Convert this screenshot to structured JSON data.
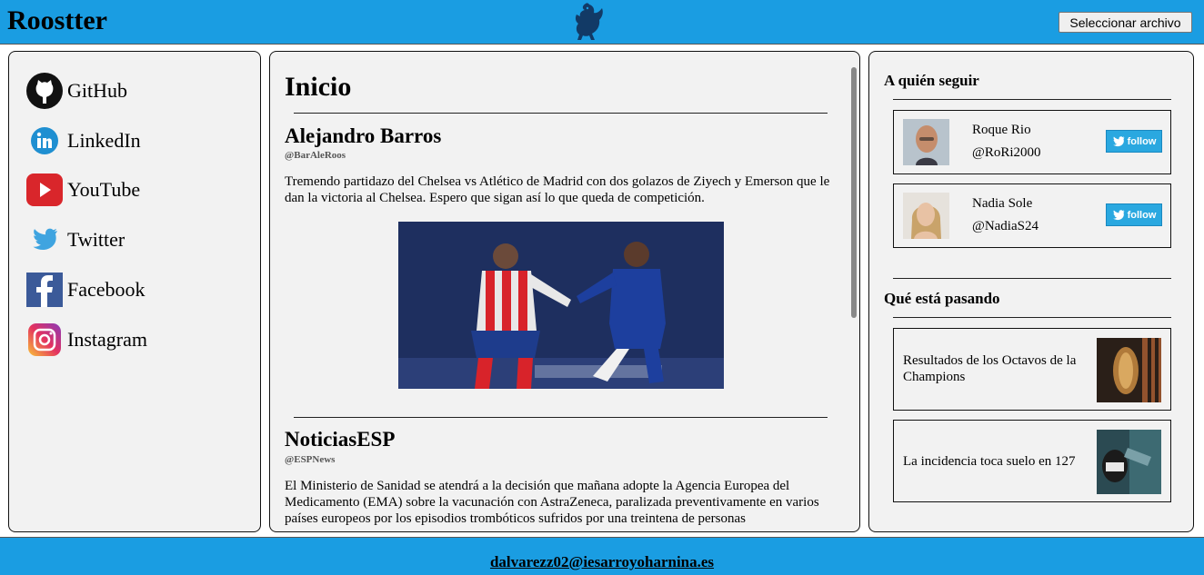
{
  "header": {
    "brand": "Roostter",
    "logo_icon": "rooster-icon",
    "file_button": "Seleccionar archivo",
    "bg_color": "#1a9de2"
  },
  "sidebar": {
    "links": [
      {
        "label": "GitHub",
        "icon": "github-icon"
      },
      {
        "label": "LinkedIn",
        "icon": "linkedin-icon"
      },
      {
        "label": "YouTube",
        "icon": "youtube-icon"
      },
      {
        "label": "Twitter",
        "icon": "twitter-icon"
      },
      {
        "label": "Facebook",
        "icon": "facebook-icon"
      },
      {
        "label": "Instagram",
        "icon": "instagram-icon"
      }
    ]
  },
  "feed": {
    "title": "Inicio",
    "posts": [
      {
        "name": "Alejandro Barros",
        "handle": "@BarAleRoos",
        "text": "Tremendo partidazo del Chelsea vs Atlético de Madrid con dos golazos de Ziyech y Emerson que le dan la victoria al Chelsea. Espero que sigan así lo que queda de competición."
      },
      {
        "name": "NoticiasESP",
        "handle": "@ESPNews",
        "text": "El Ministerio de Sanidad se atendrá a la decisión que mañana adopte la Agencia Europea del Medicamento (EMA) sobre la vacunación con AstraZeneca, paralizada preventivamente en varios países europeos por los episodios trombóticos sufridos por una treintena de personas"
      }
    ]
  },
  "right": {
    "follow_title": "A quién seguir",
    "follow_label": "follow",
    "suggestions": [
      {
        "name": "Roque Rio",
        "handle": "@RoRi2000"
      },
      {
        "name": "Nadia Sole",
        "handle": "@NadiaS24"
      }
    ],
    "trends_title": "Qué está pasando",
    "trends": [
      {
        "text": "Resultados de los Octavos de la Champions"
      },
      {
        "text": "La incidencia toca suelo en 127"
      }
    ]
  },
  "footer": {
    "email": "dalvarezz02@iesarroyoharnina.es"
  }
}
